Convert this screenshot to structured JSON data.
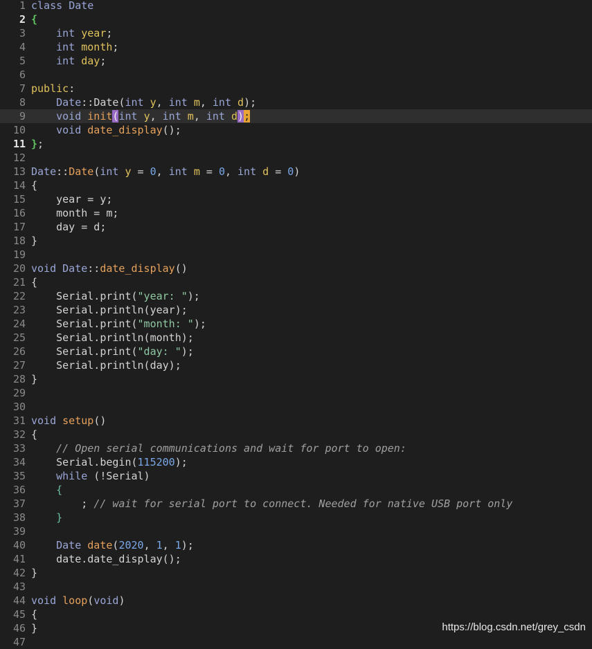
{
  "editor": {
    "current_line": 9,
    "lines": [
      {
        "n": "1",
        "bold": false,
        "tokens": [
          [
            "class",
            "t-keyword"
          ],
          [
            " ",
            "t-plain"
          ],
          [
            "Date",
            "t-class"
          ]
        ]
      },
      {
        "n": "2",
        "bold": true,
        "tokens": [
          [
            "{",
            "t-brace-green"
          ]
        ]
      },
      {
        "n": "3",
        "bold": false,
        "tokens": [
          [
            "    ",
            "t-plain"
          ],
          [
            "int",
            "t-type"
          ],
          [
            " ",
            "t-plain"
          ],
          [
            "year",
            "t-param"
          ],
          [
            ";",
            "t-punct"
          ]
        ]
      },
      {
        "n": "4",
        "bold": false,
        "tokens": [
          [
            "    ",
            "t-plain"
          ],
          [
            "int",
            "t-type"
          ],
          [
            " ",
            "t-plain"
          ],
          [
            "month",
            "t-param"
          ],
          [
            ";",
            "t-punct"
          ]
        ]
      },
      {
        "n": "5",
        "bold": false,
        "tokens": [
          [
            "    ",
            "t-plain"
          ],
          [
            "int",
            "t-type"
          ],
          [
            " ",
            "t-plain"
          ],
          [
            "day",
            "t-param"
          ],
          [
            ";",
            "t-punct"
          ]
        ]
      },
      {
        "n": "6",
        "bold": false,
        "tokens": []
      },
      {
        "n": "7",
        "bold": false,
        "tokens": [
          [
            "public",
            "t-access"
          ],
          [
            ":",
            "t-punct"
          ]
        ]
      },
      {
        "n": "8",
        "bold": false,
        "tokens": [
          [
            "    ",
            "t-plain"
          ],
          [
            "Date",
            "t-class"
          ],
          [
            "::",
            "t-punct"
          ],
          [
            "Date",
            "t-plain"
          ],
          [
            "(",
            "t-punct"
          ],
          [
            "int",
            "t-type"
          ],
          [
            " ",
            "t-plain"
          ],
          [
            "y",
            "t-param"
          ],
          [
            ", ",
            "t-punct"
          ],
          [
            "int",
            "t-type"
          ],
          [
            " ",
            "t-plain"
          ],
          [
            "m",
            "t-param"
          ],
          [
            ", ",
            "t-punct"
          ],
          [
            "int",
            "t-type"
          ],
          [
            " ",
            "t-plain"
          ],
          [
            "d",
            "t-param"
          ],
          [
            ");",
            "t-punct"
          ]
        ]
      },
      {
        "n": "9",
        "bold": false,
        "tokens": [
          [
            "    ",
            "t-plain"
          ],
          [
            "void",
            "t-type"
          ],
          [
            " ",
            "t-plain"
          ],
          [
            "init",
            "t-func"
          ],
          [
            "(",
            "t-match-purple"
          ],
          [
            "int",
            "t-type"
          ],
          [
            " ",
            "t-plain"
          ],
          [
            "y",
            "t-param"
          ],
          [
            ", ",
            "t-punct"
          ],
          [
            "int",
            "t-type"
          ],
          [
            " ",
            "t-plain"
          ],
          [
            "m",
            "t-param"
          ],
          [
            ", ",
            "t-punct"
          ],
          [
            "int",
            "t-type"
          ],
          [
            " ",
            "t-plain"
          ],
          [
            "d",
            "t-param"
          ],
          [
            ")",
            "t-match-purple"
          ],
          [
            ";",
            "t-match-orange"
          ]
        ]
      },
      {
        "n": "10",
        "bold": false,
        "tokens": [
          [
            "    ",
            "t-plain"
          ],
          [
            "void",
            "t-type"
          ],
          [
            " ",
            "t-plain"
          ],
          [
            "date_display",
            "t-func"
          ],
          [
            "();",
            "t-punct"
          ]
        ]
      },
      {
        "n": "11",
        "bold": true,
        "tokens": [
          [
            "}",
            "t-brace-green"
          ],
          [
            ";",
            "t-punct"
          ]
        ]
      },
      {
        "n": "12",
        "bold": false,
        "tokens": []
      },
      {
        "n": "13",
        "bold": false,
        "tokens": [
          [
            "Date",
            "t-class"
          ],
          [
            "::",
            "t-punct"
          ],
          [
            "Date",
            "t-func"
          ],
          [
            "(",
            "t-punct"
          ],
          [
            "int",
            "t-type"
          ],
          [
            " ",
            "t-plain"
          ],
          [
            "y",
            "t-param"
          ],
          [
            " = ",
            "t-punct"
          ],
          [
            "0",
            "t-num"
          ],
          [
            ", ",
            "t-punct"
          ],
          [
            "int",
            "t-type"
          ],
          [
            " ",
            "t-plain"
          ],
          [
            "m",
            "t-param"
          ],
          [
            " = ",
            "t-punct"
          ],
          [
            "0",
            "t-num"
          ],
          [
            ", ",
            "t-punct"
          ],
          [
            "int",
            "t-type"
          ],
          [
            " ",
            "t-plain"
          ],
          [
            "d",
            "t-param"
          ],
          [
            " = ",
            "t-punct"
          ],
          [
            "0",
            "t-num"
          ],
          [
            ")",
            "t-punct"
          ]
        ]
      },
      {
        "n": "14",
        "bold": false,
        "tokens": [
          [
            "{",
            "t-punct"
          ]
        ]
      },
      {
        "n": "15",
        "bold": false,
        "tokens": [
          [
            "    year = y;",
            "t-plain"
          ]
        ]
      },
      {
        "n": "16",
        "bold": false,
        "tokens": [
          [
            "    month = m;",
            "t-plain"
          ]
        ]
      },
      {
        "n": "17",
        "bold": false,
        "tokens": [
          [
            "    day = d;",
            "t-plain"
          ]
        ]
      },
      {
        "n": "18",
        "bold": false,
        "tokens": [
          [
            "}",
            "t-punct"
          ]
        ]
      },
      {
        "n": "19",
        "bold": false,
        "tokens": []
      },
      {
        "n": "20",
        "bold": false,
        "tokens": [
          [
            "void",
            "t-type"
          ],
          [
            " ",
            "t-plain"
          ],
          [
            "Date",
            "t-class"
          ],
          [
            "::",
            "t-punct"
          ],
          [
            "date_display",
            "t-func"
          ],
          [
            "()",
            "t-punct"
          ]
        ]
      },
      {
        "n": "21",
        "bold": false,
        "tokens": [
          [
            "{",
            "t-punct"
          ]
        ]
      },
      {
        "n": "22",
        "bold": false,
        "tokens": [
          [
            "    Serial.print(",
            "t-plain"
          ],
          [
            "\"year: \"",
            "t-str"
          ],
          [
            ");",
            "t-punct"
          ]
        ]
      },
      {
        "n": "23",
        "bold": false,
        "tokens": [
          [
            "    Serial.println(year);",
            "t-plain"
          ]
        ]
      },
      {
        "n": "24",
        "bold": false,
        "tokens": [
          [
            "    Serial.print(",
            "t-plain"
          ],
          [
            "\"month: \"",
            "t-str"
          ],
          [
            ");",
            "t-punct"
          ]
        ]
      },
      {
        "n": "25",
        "bold": false,
        "tokens": [
          [
            "    Serial.println(month);",
            "t-plain"
          ]
        ]
      },
      {
        "n": "26",
        "bold": false,
        "tokens": [
          [
            "    Serial.print(",
            "t-plain"
          ],
          [
            "\"day: \"",
            "t-str"
          ],
          [
            ");",
            "t-punct"
          ]
        ]
      },
      {
        "n": "27",
        "bold": false,
        "tokens": [
          [
            "    Serial.println(day);",
            "t-plain"
          ]
        ]
      },
      {
        "n": "28",
        "bold": false,
        "tokens": [
          [
            "}",
            "t-punct"
          ]
        ]
      },
      {
        "n": "29",
        "bold": false,
        "tokens": []
      },
      {
        "n": "30",
        "bold": false,
        "tokens": []
      },
      {
        "n": "31",
        "bold": false,
        "tokens": [
          [
            "void",
            "t-type"
          ],
          [
            " ",
            "t-plain"
          ],
          [
            "setup",
            "t-func"
          ],
          [
            "()",
            "t-punct"
          ]
        ]
      },
      {
        "n": "32",
        "bold": false,
        "tokens": [
          [
            "{",
            "t-punct"
          ]
        ]
      },
      {
        "n": "33",
        "bold": false,
        "tokens": [
          [
            "    ",
            "t-plain"
          ],
          [
            "// Open serial communications and wait for port to open:",
            "t-comment"
          ]
        ]
      },
      {
        "n": "34",
        "bold": false,
        "tokens": [
          [
            "    Serial.begin(",
            "t-plain"
          ],
          [
            "115200",
            "t-num"
          ],
          [
            ");",
            "t-punct"
          ]
        ]
      },
      {
        "n": "35",
        "bold": false,
        "tokens": [
          [
            "    ",
            "t-plain"
          ],
          [
            "while",
            "t-keyword"
          ],
          [
            " (!Serial)",
            "t-plain"
          ]
        ]
      },
      {
        "n": "36",
        "bold": false,
        "tokens": [
          [
            "    ",
            "t-plain"
          ],
          [
            "{",
            "t-brace-teal"
          ]
        ]
      },
      {
        "n": "37",
        "bold": false,
        "tokens": [
          [
            "        ; ",
            "t-plain"
          ],
          [
            "// wait for serial port to connect. Needed for native USB port only",
            "t-comment"
          ]
        ]
      },
      {
        "n": "38",
        "bold": false,
        "tokens": [
          [
            "    ",
            "t-plain"
          ],
          [
            "}",
            "t-brace-teal"
          ]
        ]
      },
      {
        "n": "39",
        "bold": false,
        "tokens": []
      },
      {
        "n": "40",
        "bold": false,
        "tokens": [
          [
            "    ",
            "t-plain"
          ],
          [
            "Date",
            "t-class"
          ],
          [
            " ",
            "t-plain"
          ],
          [
            "date",
            "t-func"
          ],
          [
            "(",
            "t-punct"
          ],
          [
            "2020",
            "t-num"
          ],
          [
            ", ",
            "t-punct"
          ],
          [
            "1",
            "t-num"
          ],
          [
            ", ",
            "t-punct"
          ],
          [
            "1",
            "t-num"
          ],
          [
            ");",
            "t-punct"
          ]
        ]
      },
      {
        "n": "41",
        "bold": false,
        "tokens": [
          [
            "    date.date_display();",
            "t-plain"
          ]
        ]
      },
      {
        "n": "42",
        "bold": false,
        "tokens": [
          [
            "}",
            "t-punct"
          ]
        ]
      },
      {
        "n": "43",
        "bold": false,
        "tokens": []
      },
      {
        "n": "44",
        "bold": false,
        "tokens": [
          [
            "void",
            "t-type"
          ],
          [
            " ",
            "t-plain"
          ],
          [
            "loop",
            "t-func"
          ],
          [
            "(",
            "t-punct"
          ],
          [
            "void",
            "t-type"
          ],
          [
            ")",
            "t-punct"
          ]
        ]
      },
      {
        "n": "45",
        "bold": false,
        "tokens": [
          [
            "{",
            "t-punct"
          ]
        ]
      },
      {
        "n": "46",
        "bold": false,
        "tokens": [
          [
            "}",
            "t-punct"
          ]
        ]
      },
      {
        "n": "47",
        "bold": false,
        "tokens": []
      }
    ]
  },
  "watermark": "https://blog.csdn.net/grey_csdn"
}
